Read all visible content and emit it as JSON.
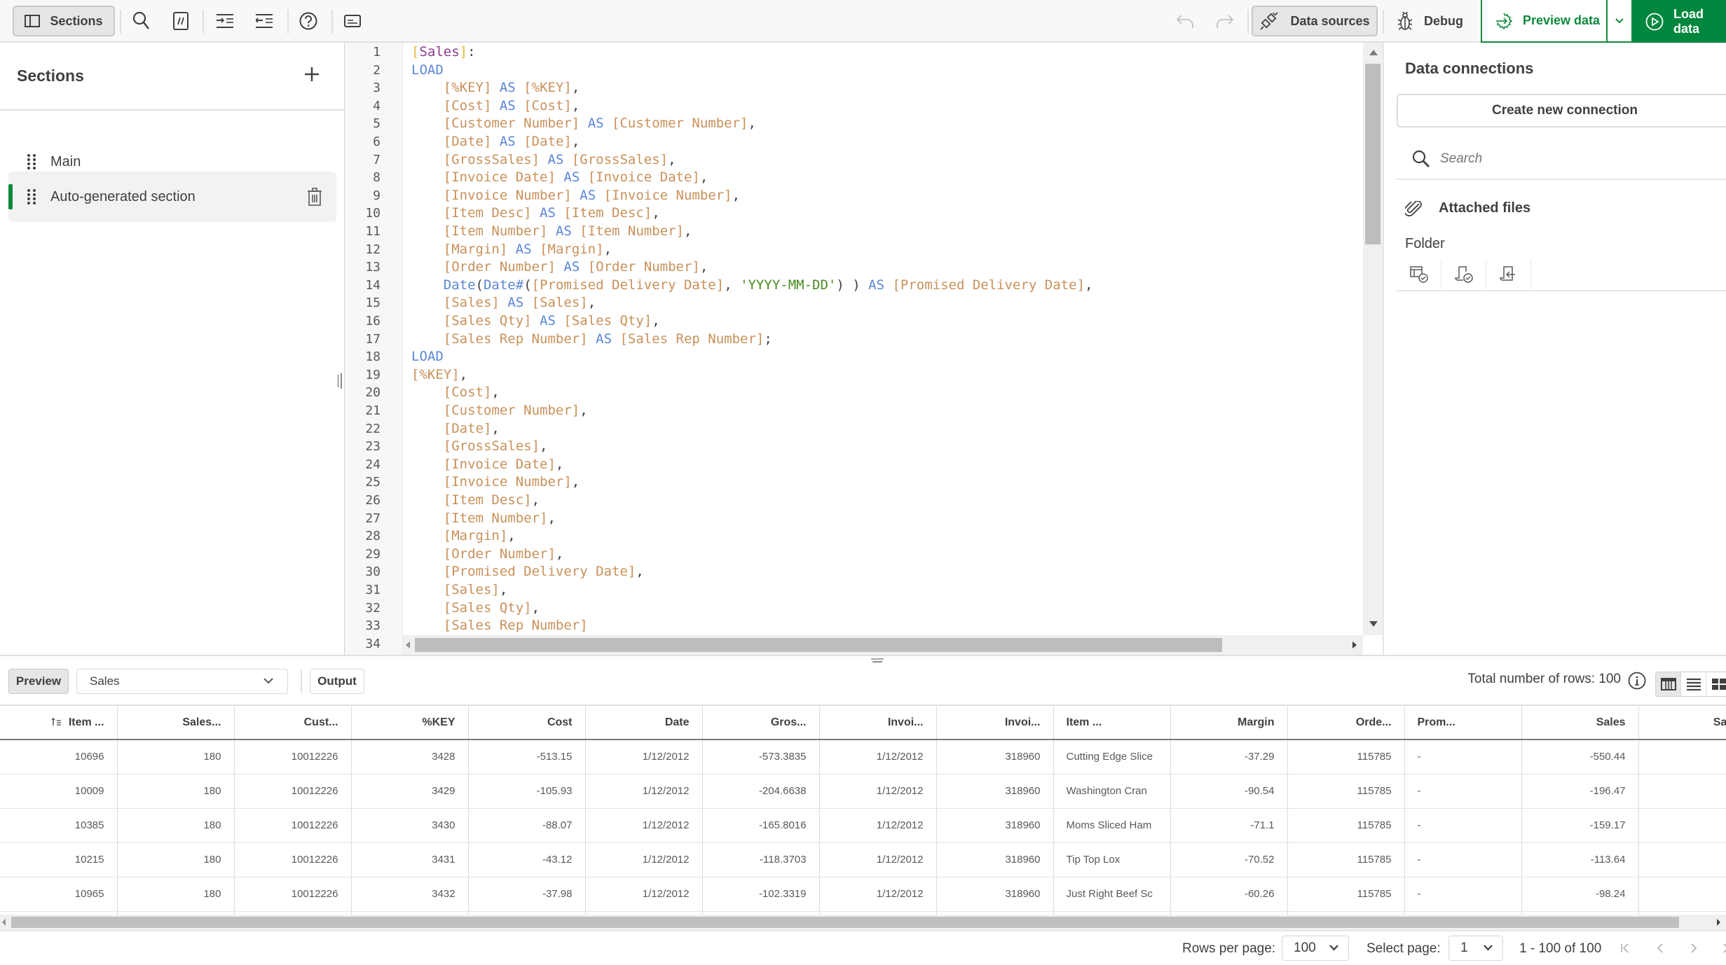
{
  "toolbar": {
    "sections_label": "Sections",
    "data_sources_label": "Data sources",
    "debug_label": "Debug",
    "preview_data_label": "Preview data",
    "load_data_label": "Load data",
    "icons": [
      "sections-panel-icon",
      "search-icon",
      "comment-icon",
      "indent-icon",
      "outdent-icon",
      "help-icon",
      "output-panel-icon",
      "undo-icon",
      "redo-icon",
      "plug-icon",
      "bug-icon",
      "gear-arrow-icon",
      "chevron-down-icon",
      "play-circle-icon"
    ],
    "colors": {
      "accent": "#00873d",
      "preview_text": "#0e8a3c"
    }
  },
  "sections": {
    "title": "Sections",
    "items": [
      {
        "label": "Main",
        "active": false
      },
      {
        "label": "Auto-generated section",
        "active": true
      }
    ]
  },
  "editor": {
    "line_numbers": [
      "1",
      "2",
      "3",
      "4",
      "5",
      "6",
      "7",
      "8",
      "9",
      "10",
      "11",
      "12",
      "13",
      "14",
      "15",
      "16",
      "17",
      "18",
      "19",
      "20",
      "21",
      "22",
      "23",
      "24",
      "25",
      "26",
      "27",
      "28",
      "29",
      "30",
      "31",
      "32",
      "33",
      "34"
    ],
    "lines": [
      [
        [
          "brk",
          "["
        ],
        [
          "tbl",
          "Sales"
        ],
        [
          "brk",
          "]"
        ],
        [
          "pun",
          ":"
        ]
      ],
      [
        [
          "kw",
          "LOAD"
        ]
      ],
      [
        [
          "pun",
          "    "
        ],
        [
          "fld",
          "[%KEY]"
        ],
        [
          "pun",
          " "
        ],
        [
          "kw",
          "AS"
        ],
        [
          "pun",
          " "
        ],
        [
          "fld",
          "[%KEY]"
        ],
        [
          "pun",
          ","
        ]
      ],
      [
        [
          "pun",
          "    "
        ],
        [
          "fld",
          "[Cost]"
        ],
        [
          "pun",
          " "
        ],
        [
          "kw",
          "AS"
        ],
        [
          "pun",
          " "
        ],
        [
          "fld",
          "[Cost]"
        ],
        [
          "pun",
          ","
        ]
      ],
      [
        [
          "pun",
          "    "
        ],
        [
          "fld",
          "[Customer Number]"
        ],
        [
          "pun",
          " "
        ],
        [
          "kw",
          "AS"
        ],
        [
          "pun",
          " "
        ],
        [
          "fld",
          "[Customer Number]"
        ],
        [
          "pun",
          ","
        ]
      ],
      [
        [
          "pun",
          "    "
        ],
        [
          "fld",
          "[Date]"
        ],
        [
          "pun",
          " "
        ],
        [
          "kw",
          "AS"
        ],
        [
          "pun",
          " "
        ],
        [
          "fld",
          "[Date]"
        ],
        [
          "pun",
          ","
        ]
      ],
      [
        [
          "pun",
          "    "
        ],
        [
          "fld",
          "[GrossSales]"
        ],
        [
          "pun",
          " "
        ],
        [
          "kw",
          "AS"
        ],
        [
          "pun",
          " "
        ],
        [
          "fld",
          "[GrossSales]"
        ],
        [
          "pun",
          ","
        ]
      ],
      [
        [
          "pun",
          "    "
        ],
        [
          "fld",
          "[Invoice Date]"
        ],
        [
          "pun",
          " "
        ],
        [
          "kw",
          "AS"
        ],
        [
          "pun",
          " "
        ],
        [
          "fld",
          "[Invoice Date]"
        ],
        [
          "pun",
          ","
        ]
      ],
      [
        [
          "pun",
          "    "
        ],
        [
          "fld",
          "[Invoice Number]"
        ],
        [
          "pun",
          " "
        ],
        [
          "kw",
          "AS"
        ],
        [
          "pun",
          " "
        ],
        [
          "fld",
          "[Invoice Number]"
        ],
        [
          "pun",
          ","
        ]
      ],
      [
        [
          "pun",
          "    "
        ],
        [
          "fld",
          "[Item Desc]"
        ],
        [
          "pun",
          " "
        ],
        [
          "kw",
          "AS"
        ],
        [
          "pun",
          " "
        ],
        [
          "fld",
          "[Item Desc]"
        ],
        [
          "pun",
          ","
        ]
      ],
      [
        [
          "pun",
          "    "
        ],
        [
          "fld",
          "[Item Number]"
        ],
        [
          "pun",
          " "
        ],
        [
          "kw",
          "AS"
        ],
        [
          "pun",
          " "
        ],
        [
          "fld",
          "[Item Number]"
        ],
        [
          "pun",
          ","
        ]
      ],
      [
        [
          "pun",
          "    "
        ],
        [
          "fld",
          "[Margin]"
        ],
        [
          "pun",
          " "
        ],
        [
          "kw",
          "AS"
        ],
        [
          "pun",
          " "
        ],
        [
          "fld",
          "[Margin]"
        ],
        [
          "pun",
          ","
        ]
      ],
      [
        [
          "pun",
          "    "
        ],
        [
          "fld",
          "[Order Number]"
        ],
        [
          "pun",
          " "
        ],
        [
          "kw",
          "AS"
        ],
        [
          "pun",
          " "
        ],
        [
          "fld",
          "[Order Number]"
        ],
        [
          "pun",
          ","
        ]
      ],
      [
        [
          "pun",
          "    "
        ],
        [
          "kw",
          "Date"
        ],
        [
          "pun",
          "("
        ],
        [
          "kw",
          "Date#"
        ],
        [
          "pun",
          "("
        ],
        [
          "fld",
          "[Promised Delivery Date]"
        ],
        [
          "pun",
          ", "
        ],
        [
          "str",
          "'YYYY-MM-DD'"
        ],
        [
          "pun",
          ") ) "
        ],
        [
          "kw",
          "AS"
        ],
        [
          "pun",
          " "
        ],
        [
          "fld",
          "[Promised Delivery Date]"
        ],
        [
          "pun",
          ","
        ]
      ],
      [
        [
          "pun",
          "    "
        ],
        [
          "fld",
          "[Sales]"
        ],
        [
          "pun",
          " "
        ],
        [
          "kw",
          "AS"
        ],
        [
          "pun",
          " "
        ],
        [
          "fld",
          "[Sales]"
        ],
        [
          "pun",
          ","
        ]
      ],
      [
        [
          "pun",
          "    "
        ],
        [
          "fld",
          "[Sales Qty]"
        ],
        [
          "pun",
          " "
        ],
        [
          "kw",
          "AS"
        ],
        [
          "pun",
          " "
        ],
        [
          "fld",
          "[Sales Qty]"
        ],
        [
          "pun",
          ","
        ]
      ],
      [
        [
          "pun",
          "    "
        ],
        [
          "fld",
          "[Sales Rep Number]"
        ],
        [
          "pun",
          " "
        ],
        [
          "kw",
          "AS"
        ],
        [
          "pun",
          " "
        ],
        [
          "fld",
          "[Sales Rep Number]"
        ],
        [
          "pun",
          ";"
        ]
      ],
      [
        [
          "kw",
          "LOAD"
        ]
      ],
      [
        [
          "fld",
          "[%KEY]"
        ],
        [
          "pun",
          ","
        ]
      ],
      [
        [
          "pun",
          "    "
        ],
        [
          "fld",
          "[Cost]"
        ],
        [
          "pun",
          ","
        ]
      ],
      [
        [
          "pun",
          "    "
        ],
        [
          "fld",
          "[Customer Number]"
        ],
        [
          "pun",
          ","
        ]
      ],
      [
        [
          "pun",
          "    "
        ],
        [
          "fld",
          "[Date]"
        ],
        [
          "pun",
          ","
        ]
      ],
      [
        [
          "pun",
          "    "
        ],
        [
          "fld",
          "[GrossSales]"
        ],
        [
          "pun",
          ","
        ]
      ],
      [
        [
          "pun",
          "    "
        ],
        [
          "fld",
          "[Invoice Date]"
        ],
        [
          "pun",
          ","
        ]
      ],
      [
        [
          "pun",
          "    "
        ],
        [
          "fld",
          "[Invoice Number]"
        ],
        [
          "pun",
          ","
        ]
      ],
      [
        [
          "pun",
          "    "
        ],
        [
          "fld",
          "[Item Desc]"
        ],
        [
          "pun",
          ","
        ]
      ],
      [
        [
          "pun",
          "    "
        ],
        [
          "fld",
          "[Item Number]"
        ],
        [
          "pun",
          ","
        ]
      ],
      [
        [
          "pun",
          "    "
        ],
        [
          "fld",
          "[Margin]"
        ],
        [
          "pun",
          ","
        ]
      ],
      [
        [
          "pun",
          "    "
        ],
        [
          "fld",
          "[Order Number]"
        ],
        [
          "pun",
          ","
        ]
      ],
      [
        [
          "pun",
          "    "
        ],
        [
          "fld",
          "[Promised Delivery Date]"
        ],
        [
          "pun",
          ","
        ]
      ],
      [
        [
          "pun",
          "    "
        ],
        [
          "fld",
          "[Sales]"
        ],
        [
          "pun",
          ","
        ]
      ],
      [
        [
          "pun",
          "    "
        ],
        [
          "fld",
          "[Sales Qty]"
        ],
        [
          "pun",
          ","
        ]
      ],
      [
        [
          "pun",
          "    "
        ],
        [
          "fld",
          "[Sales Rep Number]"
        ]
      ],
      []
    ],
    "colors": {
      "keyword": "#5b86d6",
      "field": "#c9915a",
      "string": "#4a8a22",
      "table": "#8a3d8a",
      "bracket": "#e8b839"
    }
  },
  "data_connections": {
    "title": "Data connections",
    "create_label": "Create new connection",
    "search_placeholder": "Search",
    "attached_files_label": "Attached files",
    "folder_label": "Folder",
    "folder_actions": [
      "select-data-icon",
      "insert-script-icon",
      "load-script-icon"
    ]
  },
  "preview": {
    "preview_label": "Preview",
    "table_select": "Sales",
    "output_label": "Output",
    "total_rows": "Total number of rows: 100",
    "view_modes": [
      "table-view-icon",
      "list-view-icon",
      "grid-view-icon"
    ]
  },
  "table": {
    "columns": [
      "Item ...",
      "Sales...",
      "Cust...",
      "%KEY",
      "Cost",
      "Date",
      "Gros...",
      "Invoi...",
      "Invoi...",
      "Item ...",
      "Margin",
      "Orde...",
      "Prom...",
      "Sales",
      "Sales"
    ],
    "left_aligned": [
      9,
      12
    ],
    "sort_column": 0,
    "rows": [
      [
        "10696",
        "180",
        "10012226",
        "3428",
        "-513.15",
        "1/12/2012",
        "-573.3835",
        "1/12/2012",
        "318960",
        "Cutting Edge Slice",
        "-37.29",
        "115785",
        "-",
        "-550.44",
        ""
      ],
      [
        "10009",
        "180",
        "10012226",
        "3429",
        "-105.93",
        "1/12/2012",
        "-204.6638",
        "1/12/2012",
        "318960",
        "Washington Cran",
        "-90.54",
        "115785",
        "-",
        "-196.47",
        ""
      ],
      [
        "10385",
        "180",
        "10012226",
        "3430",
        "-88.07",
        "1/12/2012",
        "-165.8016",
        "1/12/2012",
        "318960",
        "Moms Sliced Ham",
        "-71.1",
        "115785",
        "-",
        "-159.17",
        ""
      ],
      [
        "10215",
        "180",
        "10012226",
        "3431",
        "-43.12",
        "1/12/2012",
        "-118.3703",
        "1/12/2012",
        "318960",
        "Tip Top Lox",
        "-70.52",
        "115785",
        "-",
        "-113.64",
        ""
      ],
      [
        "10965",
        "180",
        "10012226",
        "3432",
        "-37.98",
        "1/12/2012",
        "-102.3319",
        "1/12/2012",
        "318960",
        "Just Right Beef Sc",
        "-60.26",
        "115785",
        "-",
        "-98.24",
        ""
      ],
      [
        "",
        "",
        "",
        "",
        "",
        "",
        "",
        "",
        "",
        "",
        "",
        "",
        "",
        "",
        ""
      ]
    ]
  },
  "pagination": {
    "rows_per_page_label": "Rows per page:",
    "rows_per_page": "100",
    "select_page_label": "Select page:",
    "page": "1",
    "range": "1 - 100 of 100"
  }
}
